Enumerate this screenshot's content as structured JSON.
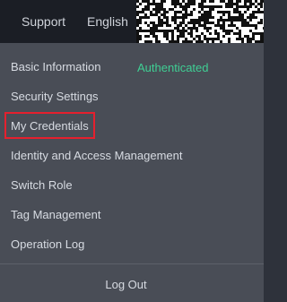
{
  "topbar": {
    "support_label": "Support",
    "language_label": "English"
  },
  "menu": {
    "items": [
      {
        "label": "Basic Information",
        "status": "Authenticated"
      },
      {
        "label": "Security Settings"
      },
      {
        "label": "My Credentials"
      },
      {
        "label": "Identity and Access Management"
      },
      {
        "label": "Switch Role"
      },
      {
        "label": "Tag Management"
      },
      {
        "label": "Operation Log"
      }
    ],
    "logout_label": "Log Out"
  },
  "colors": {
    "topbar_bg": "#1b1e25",
    "menu_bg": "#494d56",
    "text": "#d7dbe2",
    "status_green": "#3fcf94",
    "highlight_red": "#e5202e"
  }
}
